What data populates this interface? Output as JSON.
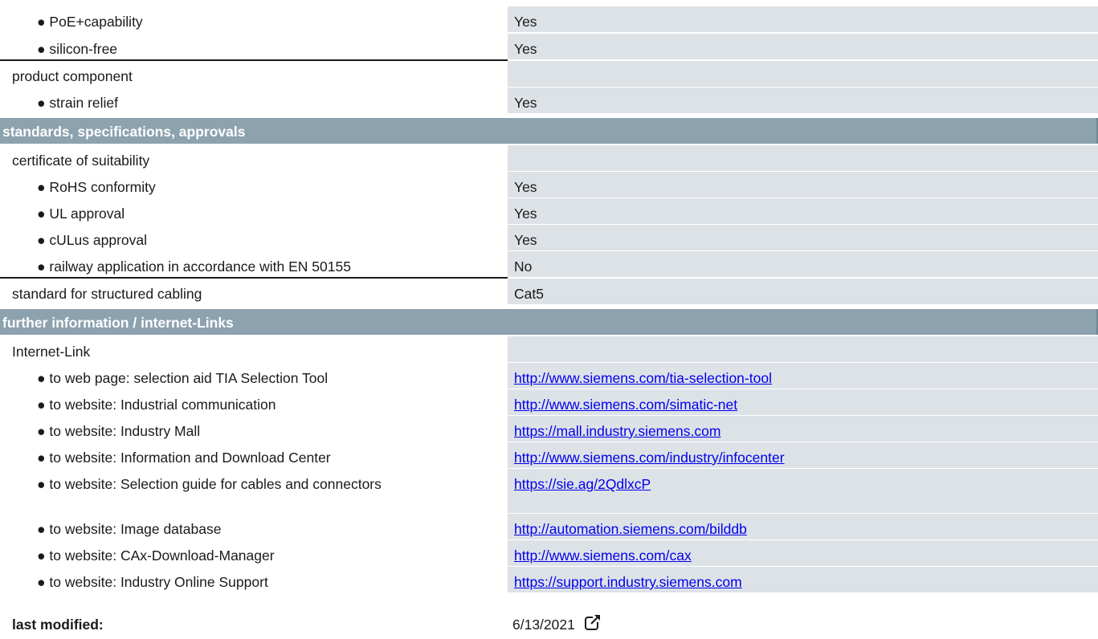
{
  "rows_a": [
    {
      "label": "● PoE+capability",
      "value": "Yes"
    },
    {
      "label": "● silicon-free",
      "value": "Yes"
    }
  ],
  "product_component": {
    "label": "product component"
  },
  "strain_relief": {
    "label": "● strain relief",
    "value": "Yes"
  },
  "section_standards": "standards, specifications, approvals",
  "certificate": {
    "label": "certificate of suitability"
  },
  "cert_rows": [
    {
      "label": "● RoHS conformity",
      "value": "Yes"
    },
    {
      "label": "● UL approval",
      "value": "Yes"
    },
    {
      "label": "● cULus approval",
      "value": "Yes"
    },
    {
      "label": "● railway application in accordance with EN 50155",
      "value": "No"
    }
  ],
  "structured_cabling": {
    "label": "standard for structured cabling",
    "value": "Cat5"
  },
  "section_links": "further information / internet-Links",
  "internet_link": {
    "label": "Internet-Link"
  },
  "links": [
    {
      "label": "● to web page: selection aid TIA Selection Tool",
      "url": "http://www.siemens.com/tia-selection-tool"
    },
    {
      "label": "● to website: Industrial communication",
      "url": "http://www.siemens.com/simatic-net"
    },
    {
      "label": "● to website: Industry Mall",
      "url": "https://mall.industry.siemens.com"
    },
    {
      "label": "● to website: Information and Download Center",
      "url": "http://www.siemens.com/industry/infocenter"
    },
    {
      "label": "● to website: Selection guide for cables and connectors",
      "url": "https://sie.ag/2QdlxcP"
    },
    {
      "label": "● to website: Image database",
      "url": "http://automation.siemens.com/bilddb"
    },
    {
      "label": "● to website: CAx-Download-Manager",
      "url": "http://www.siemens.com/cax"
    },
    {
      "label": "● to website: Industry Online Support",
      "url": "https://support.industry.siemens.com"
    }
  ],
  "footer": {
    "label": "last modified:",
    "value": "6/13/2021",
    "icon": "external-link-icon"
  },
  "colors": {
    "header_bg": "#8ca2ae",
    "value_bg": "#dde2e7",
    "link": "#0000ee"
  }
}
